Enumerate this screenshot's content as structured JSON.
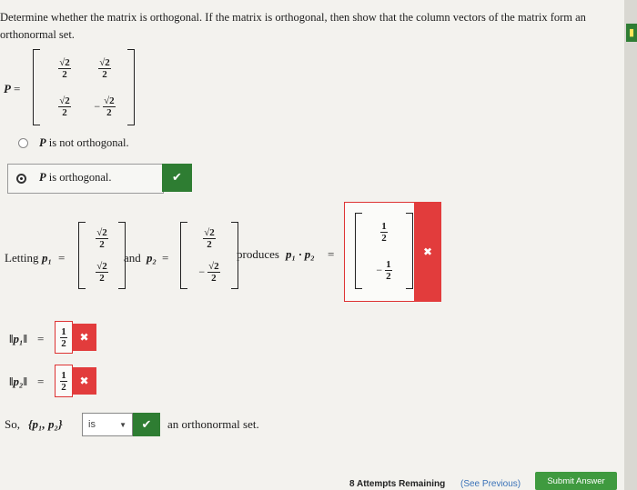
{
  "question": "Determine whether the matrix is orthogonal. If the matrix is orthogonal, then show that the column vectors of the matrix form an orthonormal set.",
  "matrix_P": {
    "label": "P",
    "equals": "=",
    "cells": [
      [
        "√2/2",
        "√2/2"
      ],
      [
        "√2/2",
        "−√2/2"
      ]
    ],
    "sqrt": "√2",
    "den": "2",
    "minus": "−"
  },
  "options": [
    {
      "label_var": "P",
      "label_text": "is not orthogonal.",
      "selected": false
    },
    {
      "label_var": "P",
      "label_text": "is orthogonal.",
      "selected": true
    }
  ],
  "feedback": {
    "correct_icon": "✔",
    "wrong_icon": "✖"
  },
  "letting": {
    "prefix": "Letting",
    "p1_label": "p₁",
    "and": "and",
    "p2_label": "p₂",
    "equals": "=",
    "produces": "produces",
    "dot_expr": "p₁ · p₂",
    "answer_top": {
      "num": "1",
      "den": "2"
    },
    "answer_bottom": {
      "sign": "−",
      "num": "1",
      "den": "2"
    }
  },
  "norm1": {
    "label": "‖p₁‖",
    "equals": "=",
    "num": "1",
    "den": "2"
  },
  "norm2": {
    "label": "‖p₂‖",
    "equals": "=",
    "num": "1",
    "den": "2"
  },
  "conclusion": {
    "prefix": "So,",
    "set": "{p₁, p₂}",
    "dropdown_value": "is",
    "suffix": "an orthonormal set."
  },
  "footer": {
    "attempts": "8 Attempts Remaining",
    "see_previous": "(See Previous)",
    "submit": "Submit Answer"
  },
  "colors": {
    "correct": "#2e7d32",
    "wrong": "#e23c3c",
    "submit": "#3f9a3f"
  }
}
